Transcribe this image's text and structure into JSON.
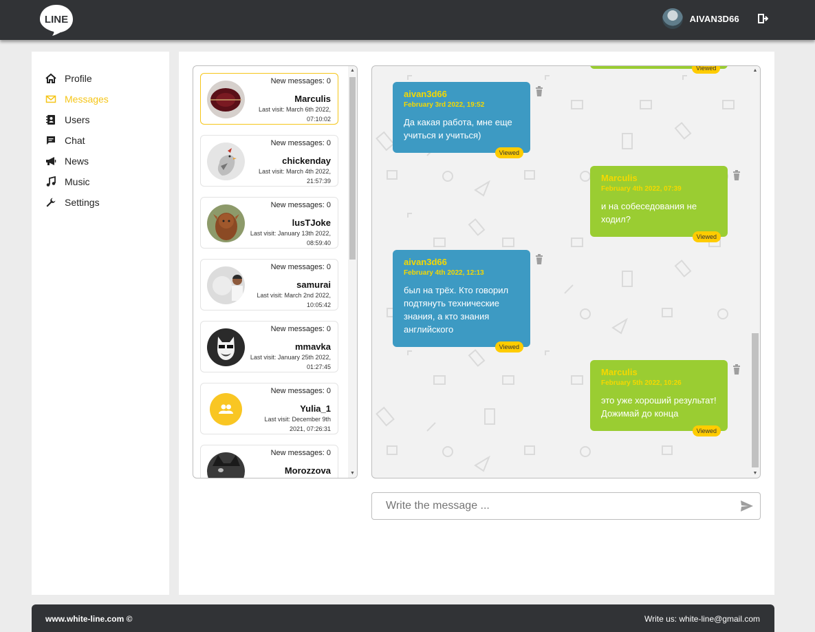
{
  "header": {
    "logo_text": "LINE",
    "username": "AIVAN3D66",
    "logout_icon": "logout-icon"
  },
  "sidebar": {
    "items": [
      {
        "label": "Profile",
        "icon": "home-icon",
        "active": false
      },
      {
        "label": "Messages",
        "icon": "envelope-icon",
        "active": true
      },
      {
        "label": "Users",
        "icon": "contacts-icon",
        "active": false
      },
      {
        "label": "Chat",
        "icon": "chat-icon",
        "active": false
      },
      {
        "label": "News",
        "icon": "megaphone-icon",
        "active": false
      },
      {
        "label": "Music",
        "icon": "music-icon",
        "active": false
      },
      {
        "label": "Settings",
        "icon": "wrench-icon",
        "active": false
      }
    ]
  },
  "dialogs": [
    {
      "new_messages": "New messages: 0",
      "name": "Marculis",
      "last_visit": "Last visit: March 6th 2022, 07:10:02"
    },
    {
      "new_messages": "New messages: 0",
      "name": "chickenday",
      "last_visit": "Last visit: March 4th 2022, 21:57:39"
    },
    {
      "new_messages": "New messages: 0",
      "name": "lusTJoke",
      "last_visit": "Last visit: January 13th 2022, 08:59:40"
    },
    {
      "new_messages": "New messages: 0",
      "name": "samurai",
      "last_visit": "Last visit: March 2nd 2022, 10:05:42"
    },
    {
      "new_messages": "New messages: 0",
      "name": "mmavka",
      "last_visit": "Last visit: January 25th 2022, 01:27:45"
    },
    {
      "new_messages": "New messages: 0",
      "name": "Yulia_1",
      "last_visit": "Last visit: December 9th 2021, 07:26:31"
    },
    {
      "new_messages": "New messages: 0",
      "name": "Morozzova",
      "last_visit": ""
    }
  ],
  "messages": [
    {
      "author": "aivan3d66",
      "date": "February 3rd 2022, 19:52",
      "text": "Да какая работа, мне еще учиться и учиться)",
      "status": "Viewed",
      "mine": true
    },
    {
      "author": "Marculis",
      "date": "February 4th 2022, 07:39",
      "text": "и на собеседования не ходил?",
      "status": "Viewed",
      "mine": false
    },
    {
      "author": "aivan3d66",
      "date": "February 4th 2022, 12:13",
      "text": "был на трёх. Кто говорил подтянуть технические знания, а кто знания английского",
      "status": "Viewed",
      "mine": true
    },
    {
      "author": "Marculis",
      "date": "February 5th 2022, 10:26",
      "text": "это уже хороший результат! Дожимай до конца",
      "status": "Viewed",
      "mine": false
    }
  ],
  "top_partial_message": {
    "status": "Viewed"
  },
  "composer": {
    "placeholder": "Write the message ..."
  },
  "footer": {
    "copyright": "www.white-line.com ©",
    "contact": "Write us: white-line@gmail.com"
  },
  "colors": {
    "header_bg": "#313336",
    "accent": "#f5c518",
    "my_message": "#3d9ac3",
    "their_message": "#9acd32",
    "viewed_badge": "#ffcc00"
  }
}
